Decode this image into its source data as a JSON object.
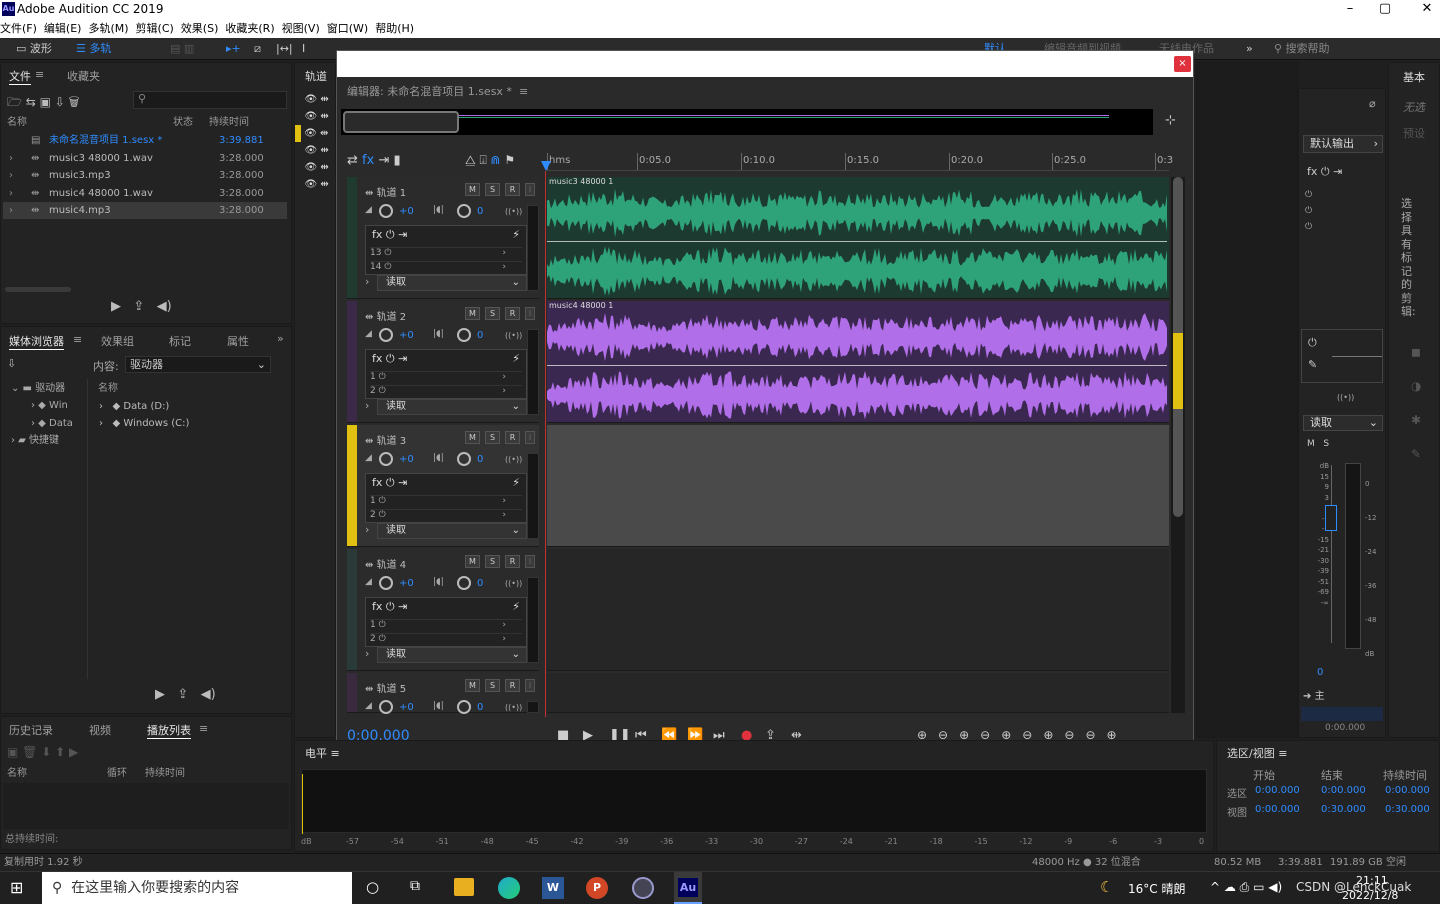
{
  "app": {
    "title": "Adobe Audition CC 2019",
    "logo": "Au",
    "window_controls": [
      "–",
      "▢",
      "✕"
    ]
  },
  "menu": [
    "文件(F)",
    "编辑(E)",
    "多轨(M)",
    "剪辑(C)",
    "效果(S)",
    "收藏夹(R)",
    "视图(V)",
    "窗口(W)",
    "帮助(H)"
  ],
  "toolbar": {
    "waveform_label": "波形",
    "multitrack_label": "多轨",
    "workspaces": [
      "默认",
      "编辑音频到视频",
      "无线电作品"
    ],
    "search_placeholder": "搜索帮助"
  },
  "files_panel": {
    "tabs": [
      "文件",
      "收藏夹"
    ],
    "columns": [
      "名称",
      "状态",
      "持续时间"
    ],
    "items": [
      {
        "name": "未命名混音项目 1.sesx *",
        "duration": "3:39.881"
      },
      {
        "name": "music3 48000 1.wav",
        "duration": "3:28.000"
      },
      {
        "name": "music3.mp3",
        "duration": "3:28.000"
      },
      {
        "name": "music4 48000 1.wav",
        "duration": "3:28.000"
      },
      {
        "name": "music4.mp3",
        "duration": "3:28.000"
      }
    ]
  },
  "media_panel": {
    "tabs": [
      "媒体浏览器",
      "效果组",
      "标记",
      "属性"
    ],
    "content_label": "内容:",
    "content_value": "驱动器",
    "tree": [
      "驱动器",
      "Win",
      "Data",
      "快捷键"
    ],
    "name_col": "名称",
    "drives": [
      "Data (D:)",
      "Windows (C:)"
    ]
  },
  "history_panel": {
    "tabs": [
      "历史记录",
      "视频",
      "播放列表"
    ],
    "columns": [
      "名称",
      "循环",
      "持续时间"
    ],
    "total_label": "总持续时间:"
  },
  "tracks_panel": {
    "title": "轨道"
  },
  "editor": {
    "title": "编辑器: 未命名混音项目 1.sesx *",
    "time_display": "0:00.000",
    "ruler": [
      "hms",
      "0:05.0",
      "0:10.0",
      "0:15.0",
      "0:20.0",
      "0:25.0",
      "0:3"
    ],
    "tracks": [
      {
        "name": "轨道 1",
        "vol": "+0",
        "pan": "0",
        "fx_rows": [
          "13",
          "14"
        ],
        "mode": "读取",
        "clip": "music3 48000 1",
        "color": "#2ea37a",
        "stripe": "#1f3a2f"
      },
      {
        "name": "轨道 2",
        "vol": "+0",
        "pan": "0",
        "fx_rows": [
          "1",
          "2"
        ],
        "mode": "读取",
        "clip": "music4 48000 1",
        "color": "#b06ee8",
        "stripe": "#3a2a48"
      },
      {
        "name": "轨道 3",
        "vol": "+0",
        "pan": "0",
        "fx_rows": [
          "1",
          "2"
        ],
        "mode": "读取",
        "clip": "",
        "color": "",
        "stripe": "#e0c010"
      },
      {
        "name": "轨道 4",
        "vol": "+0",
        "pan": "0",
        "fx_rows": [
          "1",
          "2"
        ],
        "mode": "读取",
        "clip": "",
        "color": "",
        "stripe": "#2a3a38"
      },
      {
        "name": "轨道 5",
        "vol": "+0",
        "pan": "0",
        "fx_rows": [],
        "mode": "",
        "clip": "",
        "color": "",
        "stripe": "#3a2a40"
      }
    ],
    "msr": [
      "M",
      "S",
      "R"
    ]
  },
  "right_panel": {
    "label_basic": "基本",
    "none_label": "无选",
    "preset_label": "预设",
    "output": "默认输出",
    "mode": "读取",
    "ms": [
      "M",
      "S"
    ],
    "db_scale": [
      "dB",
      "15",
      "9",
      "3",
      "0",
      "-3",
      "-9",
      "-15",
      "-21",
      "-30",
      "-39",
      "-51",
      "-69",
      "-∞"
    ],
    "right_scale": [
      "0",
      "-12",
      "-24",
      "-36",
      "-48",
      "dB"
    ],
    "zero": "0",
    "master": "主",
    "master_time": "0:00.000",
    "vertical_text": "选择具有标记的剪辑:"
  },
  "level_panel": {
    "title": "电平",
    "scale": [
      "dB",
      "-57",
      "-54",
      "-51",
      "-48",
      "-45",
      "-42",
      "-39",
      "-36",
      "-33",
      "-30",
      "-27",
      "-24",
      "-21",
      "-18",
      "-15",
      "-12",
      "-9",
      "-6",
      "-3",
      "0"
    ]
  },
  "selection_panel": {
    "title": "选区/视图",
    "cols": [
      "开始",
      "结束",
      "持续时间"
    ],
    "selection_label": "选区",
    "view_label": "视图",
    "selection": [
      "0:00.000",
      "0:00.000",
      "0:00.000"
    ],
    "view": [
      "0:00.000",
      "0:30.000",
      "0:30.000"
    ]
  },
  "status": {
    "left": "复制用时 1.92 秒",
    "rate": "48000 Hz ● 32 位混合",
    "mem": "80.52 MB",
    "dur": "3:39.881",
    "disk": "191.89 GB 空闲"
  },
  "taskbar": {
    "search": "在这里输入你要搜索的内容",
    "weather": "16°C 晴朗",
    "time": "21:11",
    "date": "2022/12/8",
    "watermark": "CSDN @LenckCuak"
  }
}
